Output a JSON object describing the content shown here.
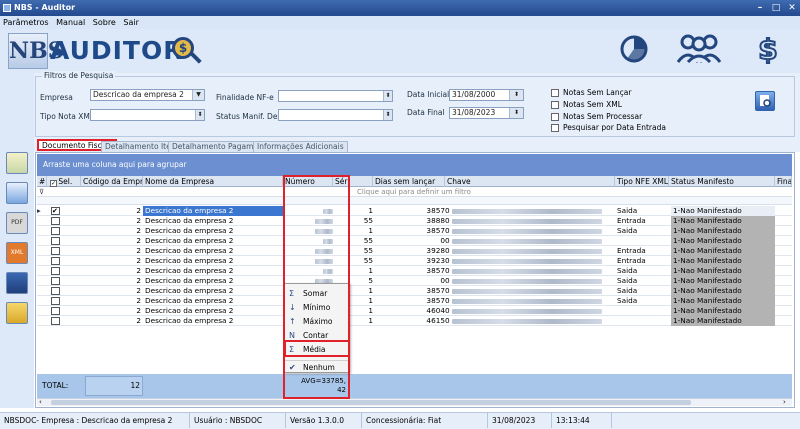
{
  "window": {
    "title": "NBS - Auditor",
    "min": "–",
    "max": "□",
    "close": "✕"
  },
  "menu": [
    "Parâmetros",
    "Manual",
    "Sobre",
    "Sair"
  ],
  "logo": {
    "letters": "NBS",
    "name": "AUDITOR"
  },
  "filters": {
    "legend": "Filtros de Pesquisa",
    "empresa_label": "Empresa",
    "empresa_value": "Descricao da empresa 2",
    "tipo_nota_label": "Tipo Nota XML",
    "tipo_nota_value": "",
    "finalidade_label": "Finalidade NF-e",
    "finalidade_value": "",
    "status_manif_label": "Status Manif. Dest:",
    "status_manif_value": "",
    "data_inicial_label": "Data Inicial",
    "data_inicial_value": "31/08/2000",
    "data_final_label": "Data Final",
    "data_final_value": "31/08/2023",
    "checks": [
      "Notas Sem Lançar",
      "Notas Sem XML",
      "Notas Sem Processar",
      "Pesquisar por Data Entrada"
    ]
  },
  "tabs": [
    "Documento Fiscais",
    "Detalhamento Itens",
    "Detalhamento Pagamento",
    "Informações Adicionais"
  ],
  "grid": {
    "group_hint": "Arraste uma coluna aqui para agrupar",
    "filter_hint": "Clique aqui para definir um filtro",
    "columns": [
      "#",
      "Sel.",
      "Código da Empr",
      "Nome da Empresa",
      "Número",
      "Série",
      "Dias sem lançar",
      "Chave",
      "Tipo  NFE  XML",
      "Status Manifesto",
      "Final"
    ],
    "rows": [
      {
        "codigo": "2",
        "nome": "Descricao da empresa 2",
        "serie": "1",
        "dias": "3857",
        "chave": "0",
        "tipo": "Saida",
        "status": "1-Nao Manifestado",
        "selected": true
      },
      {
        "codigo": "2",
        "nome": "Descricao da empresa 2",
        "serie": "55",
        "dias": "3888",
        "chave": "0",
        "tipo": "Entrada",
        "status": "1-Nao Manifestado",
        "selected": false
      },
      {
        "codigo": "2",
        "nome": "Descricao da empresa 2",
        "serie": "1",
        "dias": "3857",
        "chave": "0",
        "tipo": "Saida",
        "status": "1-Nao Manifestado",
        "selected": false
      },
      {
        "codigo": "2",
        "nome": "Descricao da empresa 2",
        "serie": "55",
        "dias": "0",
        "chave": "0",
        "tipo": "",
        "status": "1-Nao Manifestado",
        "selected": false
      },
      {
        "codigo": "2",
        "nome": "Descricao da empresa 2",
        "serie": "55",
        "dias": "3928",
        "chave": "0",
        "tipo": "Entrada",
        "status": "1-Nao Manifestado",
        "selected": false
      },
      {
        "codigo": "2",
        "nome": "Descricao da empresa 2",
        "serie": "55",
        "dias": "3923",
        "chave": "0",
        "tipo": "Entrada",
        "status": "1-Nao Manifestado",
        "selected": false
      },
      {
        "codigo": "2",
        "nome": "Descricao da empresa 2",
        "serie": "1",
        "dias": "3857",
        "chave": "0",
        "tipo": "Saida",
        "status": "1-Nao Manifestado",
        "selected": false
      },
      {
        "codigo": "2",
        "nome": "Descricao da empresa 2",
        "serie": "5",
        "dias": "0",
        "chave": "0",
        "tipo": "Saida",
        "status": "1-Nao Manifestado",
        "selected": false
      },
      {
        "codigo": "2",
        "nome": "Descricao da empresa 2",
        "serie": "1",
        "dias": "3857",
        "chave": "0",
        "tipo": "Saida",
        "status": "1-Nao Manifestado",
        "selected": false
      },
      {
        "codigo": "2",
        "nome": "Descricao da empresa 2",
        "serie": "1",
        "dias": "3857",
        "chave": "0",
        "tipo": "Saida",
        "status": "1-Nao Manifestado",
        "selected": false
      },
      {
        "codigo": "2",
        "nome": "Descricao da empresa 2",
        "serie": "1",
        "dias": "4604",
        "chave": "0",
        "tipo": "",
        "status": "1-Nao Manifestado",
        "selected": false
      },
      {
        "codigo": "2",
        "nome": "Descricao da empresa 2",
        "serie": "1",
        "dias": "4615",
        "chave": "0",
        "tipo": "",
        "status": "1-Nao Manifestado",
        "selected": false
      }
    ],
    "total_label": "TOTAL:",
    "total_value": "12",
    "avg_line1": "AVG=33785,",
    "avg_line2": "42"
  },
  "context_menu": [
    {
      "icon": "Σ",
      "label": "Somar"
    },
    {
      "icon": "↓",
      "label": "Mínimo"
    },
    {
      "icon": "↑",
      "label": "Máximo"
    },
    {
      "icon": "N",
      "label": "Contar"
    },
    {
      "icon": "Σ",
      "label": "Média"
    },
    {
      "icon": "✔",
      "label": "Nenhum"
    }
  ],
  "status_bar": {
    "company": "NBSDOC- Empresa : Descricao da empresa 2",
    "user": "Usuário : NBSDOC",
    "version": "Versão 1.3.0.0",
    "dealer": "Concessionária: Fiat",
    "date": "31/08/2023",
    "time": "13:13:44"
  }
}
